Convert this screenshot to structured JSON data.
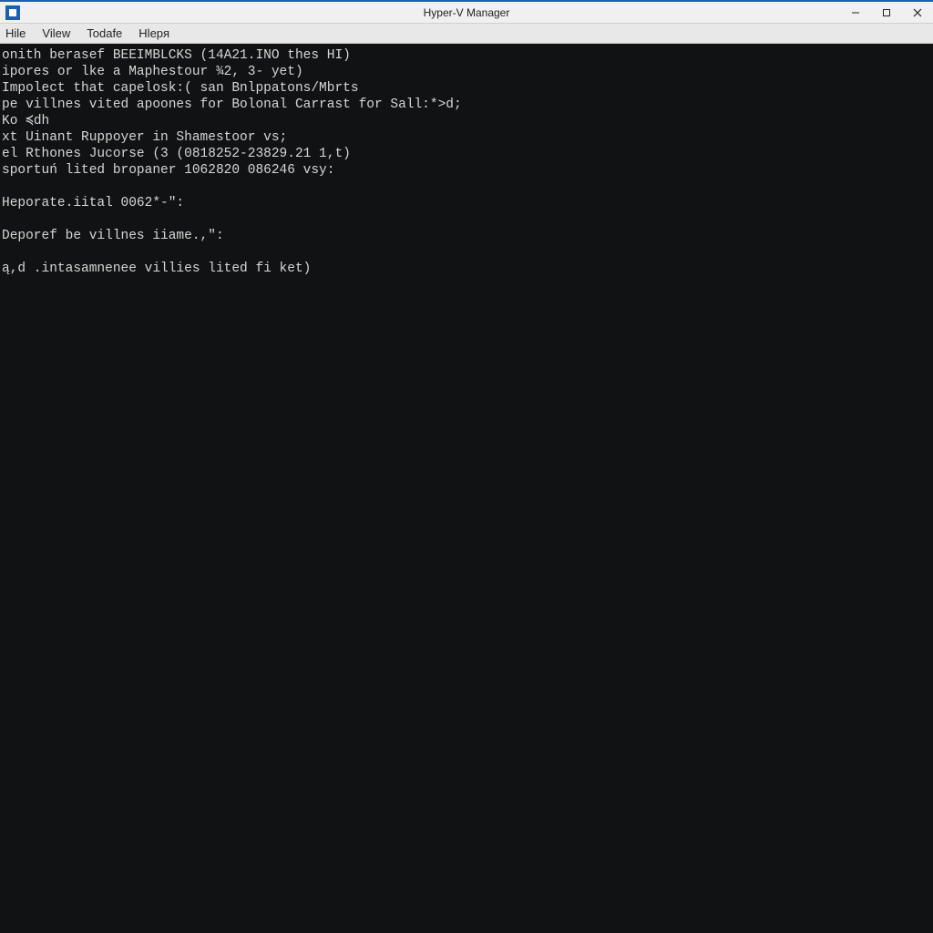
{
  "window": {
    "title": "Hyper-V Manager"
  },
  "menubar": {
    "items": [
      {
        "label": "Hile"
      },
      {
        "label": "Vilew"
      },
      {
        "label": "Todafe"
      },
      {
        "label": "Hlepя"
      }
    ]
  },
  "terminal": {
    "lines": [
      "onith berasef BEEIMBLCKS (14A21.INO thes HI)",
      "ipores or lke a Maphestour ¾2, 3- yet)",
      "Impolect that capelosk:( san Bnlppatons/Mbrts",
      "pe villnes vited apoones for Bolonal Carrast for Sall:*>d;",
      "Ko ≼dh",
      "xt Uinant Ruppoyer in Shamestoor vs;",
      "el Rthones Jucorse (3 (0818252-23829.21 1,t)",
      "sportuń lited bropaner 1062820 086246 vsy:",
      "",
      "Heporate.iital 0062*-\":",
      "",
      "Deporef be villnes iiame.,\":",
      "",
      "ą,d .intasamnenee villies lited fi ket)"
    ]
  }
}
